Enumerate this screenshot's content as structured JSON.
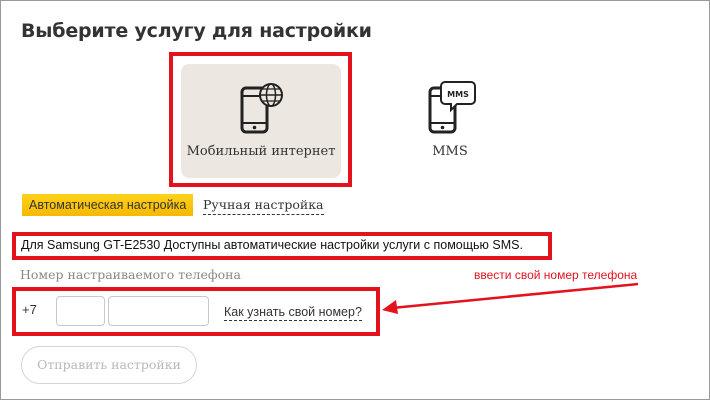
{
  "heading": "Выберите услугу для настройки",
  "services": [
    {
      "label": "Мобильный интернет",
      "icon": "phone-globe-icon",
      "selected": true
    },
    {
      "label": "MMS",
      "icon": "phone-mms-icon",
      "selected": false
    }
  ],
  "mms_icon_text": "MMS",
  "tabs": {
    "automatic": "Автоматическая настройка",
    "manual": "Ручная настройка"
  },
  "info_text": "Для Samsung GT-E2530 Доступны автоматические настройки услуги с помощью SMS.",
  "phone": {
    "label": "Номер настраиваемого телефона",
    "prefix": "+7",
    "code_value": "",
    "number_value": "",
    "help_link": "Как узнать свой номер?"
  },
  "annotation": {
    "hint": "ввести свой номер телефона",
    "color": "#e3121d"
  },
  "send_button": "Отправить настройки",
  "colors": {
    "accent_tab": "#f6b800",
    "selected_card": "#ece8e1",
    "annotation_red": "#e3121d"
  }
}
